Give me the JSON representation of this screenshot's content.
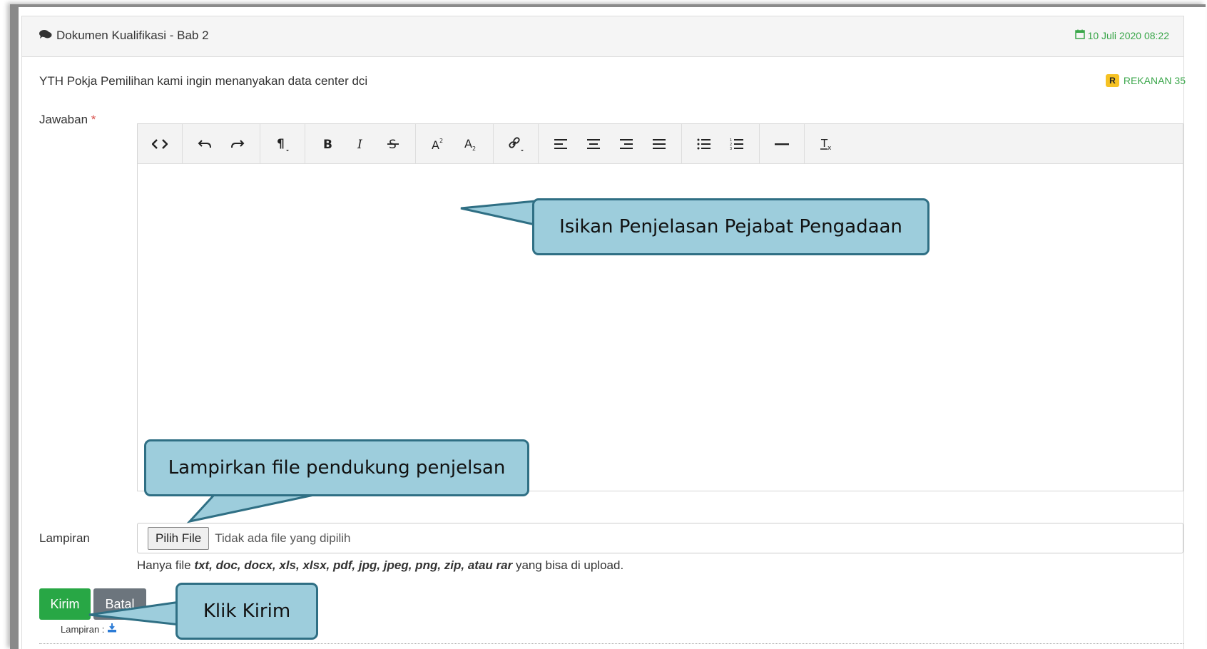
{
  "header": {
    "title": "Dokumen Kualifikasi - Bab 2",
    "date": "10 Juli 2020 08:22"
  },
  "question": {
    "text": "YTH Pokja Pemilihan kami ingin menanyakan data center dci",
    "badge": "R",
    "sender": "REKANAN 35"
  },
  "form": {
    "jawaban_label": "Jawaban",
    "required_mark": "*",
    "lampiran_label": "Lampiran",
    "file_button": "Pilih File",
    "file_status": "Tidak ada file yang dipilih",
    "hint_prefix": "Hanya file",
    "hint_types": "txt, doc, docx, xls, xlsx, pdf, jpg, jpeg, png, zip, atau rar",
    "hint_suffix": "yang bisa di upload.",
    "submit": "Kirim",
    "cancel": "Batal",
    "attachment_small": "Lampiran :"
  },
  "toolbar": {
    "groups": [
      [
        "code-view"
      ],
      [
        "undo",
        "redo"
      ],
      [
        "paragraph-format"
      ],
      [
        "bold",
        "italic",
        "strikethrough"
      ],
      [
        "superscript",
        "subscript"
      ],
      [
        "insert-link"
      ],
      [
        "align-left",
        "align-center",
        "align-right",
        "align-justify"
      ],
      [
        "unordered-list",
        "ordered-list"
      ],
      [
        "horizontal-rule"
      ],
      [
        "clear-formatting"
      ]
    ]
  },
  "callouts": {
    "editor": "Isikan Penjelasan Pejabat Pengadaan",
    "attachment": "Lampirkan file pendukung penjelsan",
    "submit": "Klik Kirim"
  },
  "colors": {
    "accent_green": "#28a745",
    "date_green": "#3aa64a",
    "callout_fill": "#9dcddc",
    "callout_border": "#2f6f84",
    "badge_yellow": "#f6c223"
  }
}
